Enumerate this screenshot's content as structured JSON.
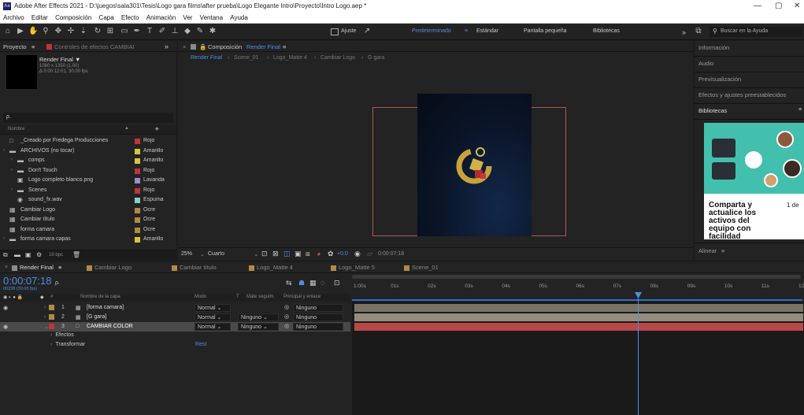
{
  "window": {
    "title": "Adobe After Effects 2021 - D:\\juegos\\sala301\\Tesis\\Logo gara films\\after prueba\\Logo Elegante Intro\\Proyecto\\Intro Logo.aep *",
    "app_icon": "Ae",
    "controls": [
      "—",
      "▢",
      "✕"
    ]
  },
  "menu": [
    "Archivo",
    "Editar",
    "Composición",
    "Capa",
    "Efecto",
    "Animación",
    "Ver",
    "Ventana",
    "Ayuda"
  ],
  "toolbar": {
    "ajuste": "Ajuste",
    "workspaces": [
      "Predeterminado",
      "Estándar",
      "Pantalla pequeña",
      "Bibliotecas"
    ],
    "chevron": "»",
    "search_placeholder": "Buscar en la Ayuda"
  },
  "project": {
    "tab_label": "Proyecto",
    "effects_tab": "Controles de efectos CAMBIAI",
    "expand": "»",
    "item_name": "Render Final ▼",
    "item_dims": "1080 x 1350 (1.00)",
    "item_duration": "Δ 0:00:12:01, 30.00 fps",
    "search_placeholder": "ρ.",
    "col_name": "Nombre",
    "items": [
      {
        "name": "_Creado por Fredega Producciones",
        "label": "Rojo",
        "color": "#c0343a",
        "kind": "file",
        "indent": 0
      },
      {
        "name": "ARCHIVOS (no tocar)",
        "label": "Amarillo",
        "color": "#d8c53c",
        "kind": "folder",
        "indent": 0
      },
      {
        "name": "comps",
        "label": "Amarillo",
        "color": "#d8c53c",
        "kind": "folder",
        "indent": 1
      },
      {
        "name": "Don't Touch",
        "label": "Rojo",
        "color": "#c0343a",
        "kind": "folder",
        "indent": 1
      },
      {
        "name": "Logo completo blanco.png",
        "label": "Lavanda",
        "color": "#a08bcc",
        "kind": "image",
        "indent": 1
      },
      {
        "name": "Scenes",
        "label": "Rojo",
        "color": "#c0343a",
        "kind": "folder",
        "indent": 1
      },
      {
        "name": "sound_fx.wav",
        "label": "Espuma",
        "color": "#8ad0c0",
        "kind": "audio",
        "indent": 1
      },
      {
        "name": "Cambiar Logo",
        "label": "Ocre",
        "color": "#b08a44",
        "kind": "comp",
        "indent": 0
      },
      {
        "name": "Cambiar título",
        "label": "Ocre",
        "color": "#b08a44",
        "kind": "comp",
        "indent": 0
      },
      {
        "name": "forma camara",
        "label": "Ocre",
        "color": "#b08a44",
        "kind": "comp",
        "indent": 0
      },
      {
        "name": "forma camara capas",
        "label": "Amarillo",
        "color": "#d8c53c",
        "kind": "folder",
        "indent": 0
      }
    ],
    "footer_bpc": "16 bpc"
  },
  "composition": {
    "tab_label": "Composición",
    "comp_name": "Render Final",
    "breadcrumbs": [
      "Render Final",
      "Scene_01",
      "Logo_Matte 4",
      "Cambiar Logo",
      "G gara"
    ],
    "zoom": "25%",
    "quality": "Cuarto",
    "exposure": "+0.0",
    "timecode": "0:00:07:18"
  },
  "right_panel": {
    "sections": [
      "Información",
      "Audio",
      "Previsualización",
      "Efectos y ajustes preestablecidos",
      "Bibliotecas"
    ],
    "promo_text": "Comparta y actualice los activos del equipo con facilidad",
    "promo_side": "1 de",
    "align": "Alinear"
  },
  "timeline": {
    "tabs": [
      {
        "name": "Render Final",
        "color": "#8a8a8a"
      },
      {
        "name": "Cambiar Logo",
        "color": "#b08a44"
      },
      {
        "name": "Cambiar título",
        "color": "#b08a44"
      },
      {
        "name": "Logo_Matte 4",
        "color": "#b08a44"
      },
      {
        "name": "Logo_Matte 5",
        "color": "#b08a44"
      },
      {
        "name": "Scene_01",
        "color": "#b08a44"
      }
    ],
    "timecode": "0:00:07:18",
    "frame_info": "00238 (30.00 fps)",
    "search_placeholder": "ρ.",
    "columns": {
      "num": "#",
      "name": "Nombre de la capa",
      "mode": "Modo",
      "t": "T",
      "mate": "Mate seguim.",
      "parent": "Principal y enlace"
    },
    "layers": [
      {
        "num": "1",
        "name": "[forma camara]",
        "mode": "Normal",
        "mate": "",
        "parent": "Ninguno",
        "color": "#b08a44",
        "selected": false
      },
      {
        "num": "2",
        "name": "[G gara]",
        "mode": "Normal",
        "mate": "Ninguno",
        "parent": "Ninguno",
        "color": "#b08a44",
        "selected": false
      },
      {
        "num": "3",
        "name": "CAMBIAR COLOR",
        "mode": "Normal",
        "mate": "Ninguno",
        "parent": "Ninguno",
        "color": "#c0343a",
        "selected": true
      }
    ],
    "sub_props": [
      "Efectos",
      "Transformar"
    ],
    "reset_label": "Rest",
    "ruler": [
      "1:00s",
      "01s",
      "02s",
      "03s",
      "04s",
      "05s",
      "06s",
      "07s",
      "08s",
      "09s",
      "10s",
      "11s",
      "12s"
    ]
  }
}
